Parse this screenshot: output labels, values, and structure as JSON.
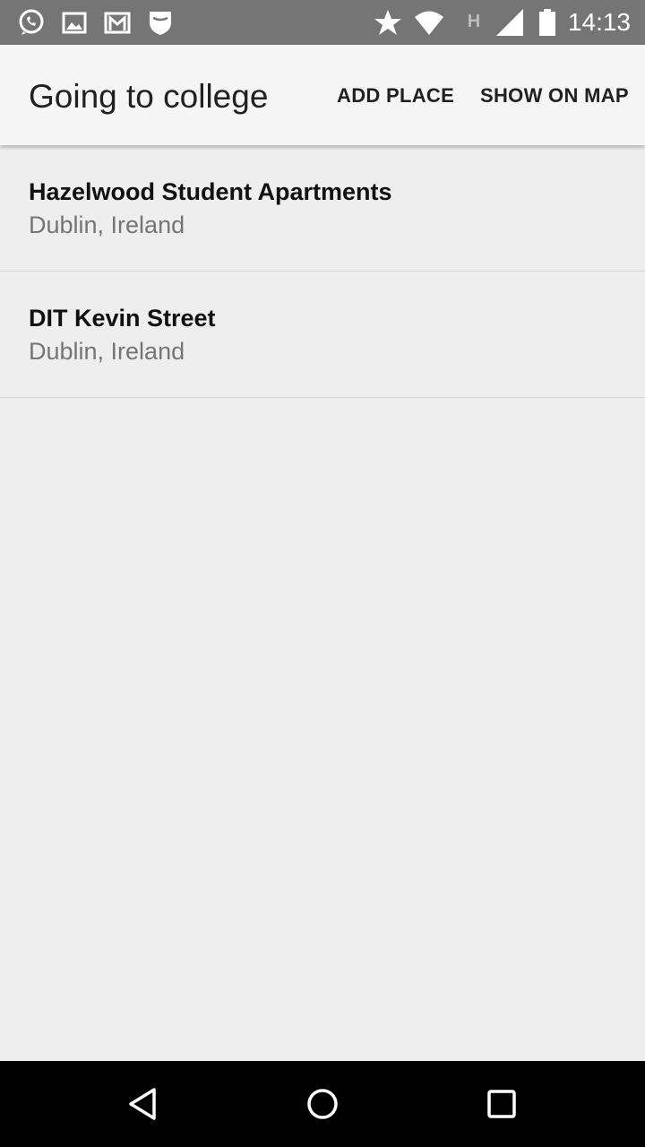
{
  "status_bar": {
    "time": "14:13",
    "left_icons": [
      "whatsapp-icon",
      "gallery-icon",
      "gmail-icon",
      "shield-icon"
    ],
    "right_icons": [
      "star-icon",
      "wifi-icon",
      "h-network-icon",
      "signal-icon",
      "battery-icon"
    ],
    "network_letter": "H"
  },
  "app_bar": {
    "title": "Going to college",
    "actions": {
      "add_place": "ADD PLACE",
      "show_on_map": "SHOW ON MAP"
    }
  },
  "places": [
    {
      "name": "Hazelwood Student Apartments",
      "location": "Dublin, Ireland"
    },
    {
      "name": "DIT Kevin Street",
      "location": "Dublin, Ireland"
    }
  ],
  "navigation_bar": {
    "buttons": [
      "back-icon",
      "home-icon",
      "recents-icon"
    ]
  }
}
